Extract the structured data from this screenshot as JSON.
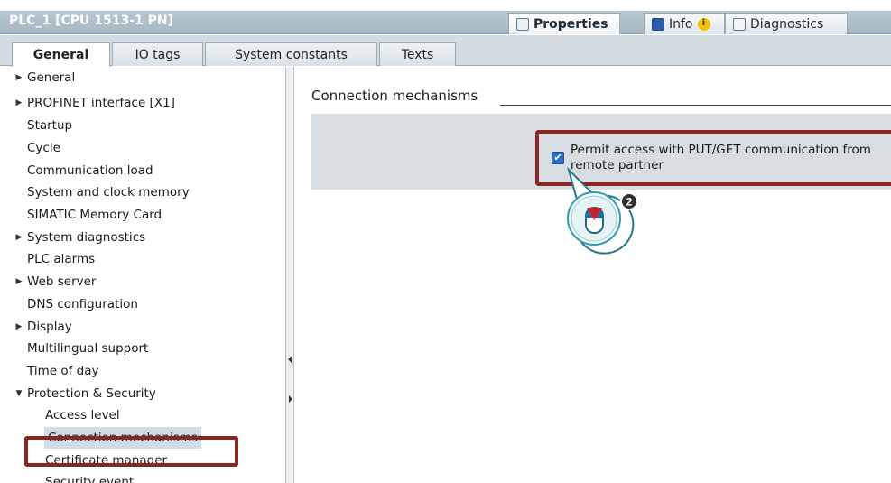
{
  "window": {
    "title": "PLC_1 [CPU 1513-1 PN]",
    "inspector_tabs": [
      {
        "label": "Properties",
        "icon": "properties-icon"
      },
      {
        "label": "Info",
        "icon": "info-icon"
      },
      {
        "label": "Diagnostics",
        "icon": "diagnostics-icon"
      }
    ],
    "info_badge": "i"
  },
  "tabs": [
    "General",
    "IO tags",
    "System constants",
    "Texts"
  ],
  "nav": [
    {
      "label": "General",
      "expandable": true,
      "expanded": false
    },
    {
      "label": "PROFINET interface [X1]",
      "expandable": true,
      "expanded": false
    },
    {
      "label": "Startup"
    },
    {
      "label": "Cycle"
    },
    {
      "label": "Communication load"
    },
    {
      "label": "System and clock memory"
    },
    {
      "label": "SIMATIC Memory Card"
    },
    {
      "label": "System diagnostics",
      "expandable": true,
      "expanded": false
    },
    {
      "label": "PLC alarms"
    },
    {
      "label": "Web server",
      "expandable": true,
      "expanded": false
    },
    {
      "label": "DNS configuration"
    },
    {
      "label": "Display",
      "expandable": true,
      "expanded": false
    },
    {
      "label": "Multilingual support"
    },
    {
      "label": "Time of day"
    },
    {
      "label": "Protection & Security",
      "expandable": true,
      "expanded": true
    },
    {
      "label": "Access level",
      "child": true
    },
    {
      "label": "Connection mechanisms",
      "child": true,
      "selected": true
    },
    {
      "label": "Certificate manager",
      "child": true
    },
    {
      "label": "Security event",
      "child": true
    }
  ],
  "content": {
    "section_title": "Connection mechanisms",
    "checkbox_label": "Permit access with PUT/GET communication from remote partner",
    "checkbox_checked": true
  },
  "callout": {
    "step": "2",
    "icon": "mouse-click-icon"
  },
  "colors": {
    "highlight": "#8b2524",
    "checkbox": "#2f6fc0",
    "titlebar": "#a7b8c4"
  }
}
